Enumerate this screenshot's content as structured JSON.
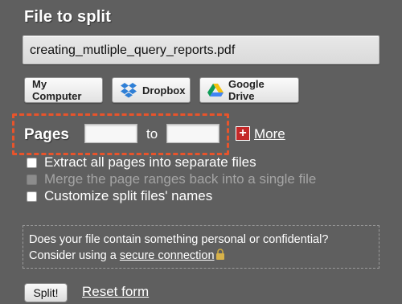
{
  "file_section": {
    "title": "File to split",
    "filename": "creating_mutliple_query_reports.pdf"
  },
  "sources": {
    "my_computer": "My Computer",
    "dropbox": "Dropbox",
    "google_drive": "Google Drive",
    "dropbox_icon": "dropbox-icon",
    "google_drive_icon": "google-drive-icon"
  },
  "pages": {
    "label": "Pages",
    "from_value": "",
    "to_label": "to",
    "to_value": "",
    "more_icon": "+",
    "more_label": "More",
    "highlight_color": "#e8542b"
  },
  "options": [
    {
      "label": "Extract all pages into separate files",
      "checked": false,
      "disabled": false
    },
    {
      "label": "Merge the page ranges back into a single file",
      "checked": false,
      "disabled": true
    },
    {
      "label": "Customize split files' names",
      "checked": false,
      "disabled": false
    }
  ],
  "notice": {
    "text_line1": "Does your file contain something personal or confidential?",
    "text_line2_prefix": "Consider using a ",
    "link": "secure connection",
    "lock_icon": "lock-icon"
  },
  "actions": {
    "split": "Split!",
    "reset": "Reset form"
  }
}
